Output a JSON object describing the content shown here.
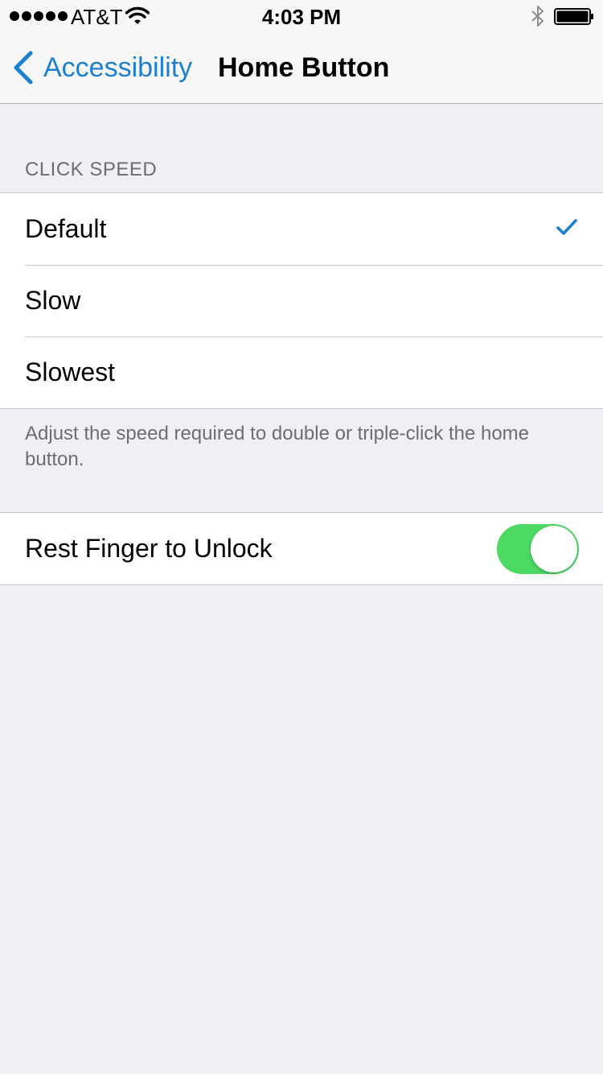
{
  "status_bar": {
    "carrier": "AT&T",
    "time": "4:03 PM",
    "signal_icon": "signal-dots-icon",
    "wifi_icon": "wifi-icon",
    "bluetooth_icon": "bluetooth-icon",
    "battery_icon": "battery-icon"
  },
  "nav": {
    "back_label": "Accessibility",
    "back_icon": "chevron-left-icon",
    "title": "Home Button"
  },
  "click_speed": {
    "header": "CLICK SPEED",
    "options": [
      {
        "label": "Default",
        "selected": true
      },
      {
        "label": "Slow",
        "selected": false
      },
      {
        "label": "Slowest",
        "selected": false
      }
    ],
    "footer": "Adjust the speed required to double or triple-click the home button."
  },
  "rest_finger": {
    "label": "Rest Finger to Unlock",
    "enabled": true
  },
  "colors": {
    "accent": "#1b7fd4",
    "toggle_on": "#4cd964",
    "background": "#efeff4"
  }
}
